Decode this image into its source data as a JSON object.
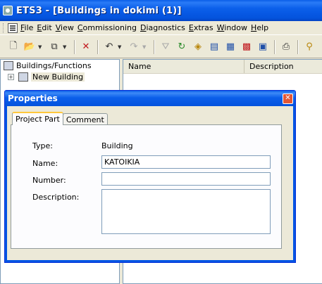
{
  "window": {
    "title": "ETS3 - [Buildings in dokimi (1)]"
  },
  "menu": {
    "items": [
      "File",
      "Edit",
      "View",
      "Commissioning",
      "Diagnostics",
      "Extras",
      "Window",
      "Help"
    ]
  },
  "toolbar": {
    "icons": [
      "new-icon",
      "open-icon",
      "copy-icon",
      "delete-icon",
      "undo-icon",
      "redo-icon",
      "filter-icon",
      "refresh-icon",
      "tag-icon",
      "print-icon",
      "find-icon"
    ]
  },
  "tree": {
    "root_label": "Buildings/Functions",
    "child_label": "New Building"
  },
  "list": {
    "columns": [
      "Name",
      "Description"
    ]
  },
  "dialog": {
    "title": "Properties",
    "tabs": [
      "Project Part",
      "Comment"
    ],
    "type_label": "Type:",
    "type_value": "Building",
    "name_label": "Name:",
    "name_value": "KATOIKIA",
    "number_label": "Number:",
    "number_value": "",
    "description_label": "Description:",
    "description_value": ""
  }
}
